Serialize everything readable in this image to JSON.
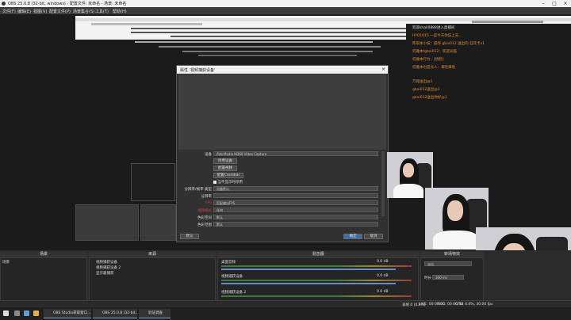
{
  "window": {
    "title": "OBS 25.0.8 (32-bit, windows) - 配置文件: 未命名 - 场景: 未命名"
  },
  "menu": [
    "文件(F)",
    "编辑(E)",
    "视图(V)",
    "配置文件(P)",
    "场景集合(S)",
    "工具(T)",
    "帮助(H)"
  ],
  "chat": {
    "header": "欢迎shali0888进入直播间",
    "lines": [
      "HYO1015 一些今天你说上去....",
      "陈琪本小枝：操作 gbai012 送出的 狂欢卡x1",
      "何雅本fgbai012：欢迎光临",
      "何雅本行为：[捂脸]",
      "何雅本也是比人：来啦来啦",
      "万能送出@1",
      "gbai012送出@1",
      "gbai012送出你好@1"
    ]
  },
  "dialog": {
    "title": "属性 '视频捕获设备'",
    "device_label": "设备",
    "device_value": "AVerMedia HD60 Video Capture",
    "btn_deactivate": "停用设备",
    "btn_configure": "配置视频",
    "btn_crossbar": "配置Crossbar",
    "checkbox": "当不显示时停用",
    "res_type_label": "分辨率/帧率 类型",
    "res_type_value": "设备默认",
    "res_label": "分辨率",
    "fps_label": "FPS",
    "fps_value": "匹配输出FPS",
    "format_label": "视频格式",
    "format_value": "任何",
    "color_space_label": "色彩空间",
    "color_space_value": "默认",
    "color_range_label": "色彩范围",
    "color_range_value": "默认",
    "defaults_btn": "默认",
    "ok_btn": "确定",
    "cancel_btn": "取消"
  },
  "docks": {
    "scenes": "场景",
    "sources": "来源",
    "mixer": "混音器",
    "transitions": "转场特效"
  },
  "scene_items": [
    "场景"
  ],
  "source_items": [
    "视频捕获设备",
    "视频捕获设备 2",
    "显示器捕获"
  ],
  "mixer_channels": [
    {
      "name": "桌面音频",
      "db": "0.0 dB"
    },
    {
      "name": "视频捕获设备",
      "db": "0.0 dB"
    },
    {
      "name": "视频捕获设备 2",
      "db": "0.0 dB"
    }
  ],
  "transition": {
    "label": "淡出",
    "duration_label": "时长",
    "duration_value": "300 ms"
  },
  "status": {
    "dropped": "丢帧 0 (0.0%)",
    "live": "LIVE: 00:00:00",
    "rec": "REC: 00:06:58",
    "cpu": "CPU: 4.6%, 30.00 fps"
  },
  "taskbar": [
    "OBS Studio获取窗口...",
    "OBS 25.0.8 (32-bit...",
    "验证调查"
  ],
  "colors": {
    "accent": "#3b6fa8",
    "chat_orange": "#e08a2e",
    "meter_green": "#3a7a3a"
  }
}
